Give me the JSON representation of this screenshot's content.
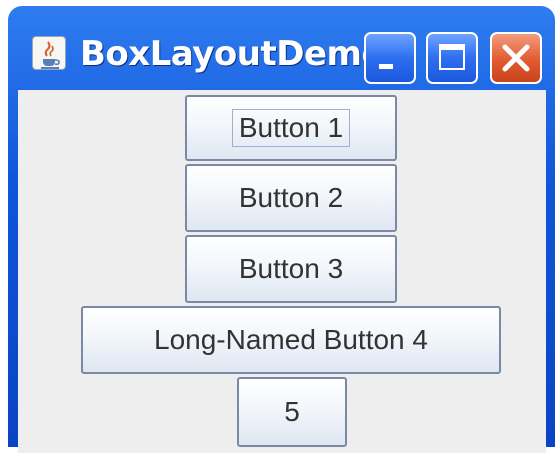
{
  "window": {
    "title": "BoxLayoutDemo",
    "controls": {
      "minimize": "minimize-icon",
      "maximize": "maximize-icon",
      "close": "close-icon"
    },
    "app_icon": "java-coffee-cup-icon"
  },
  "buttons": [
    {
      "label": "Button 1",
      "focused": true
    },
    {
      "label": "Button 2"
    },
    {
      "label": "Button 3"
    },
    {
      "label": "Long-Named Button 4"
    },
    {
      "label": "5"
    }
  ],
  "colors": {
    "titlebar": "#0f56d9",
    "client_bg": "#eeeeee",
    "close_button": "#e25a2f",
    "button_border": "#7a8aa6"
  }
}
